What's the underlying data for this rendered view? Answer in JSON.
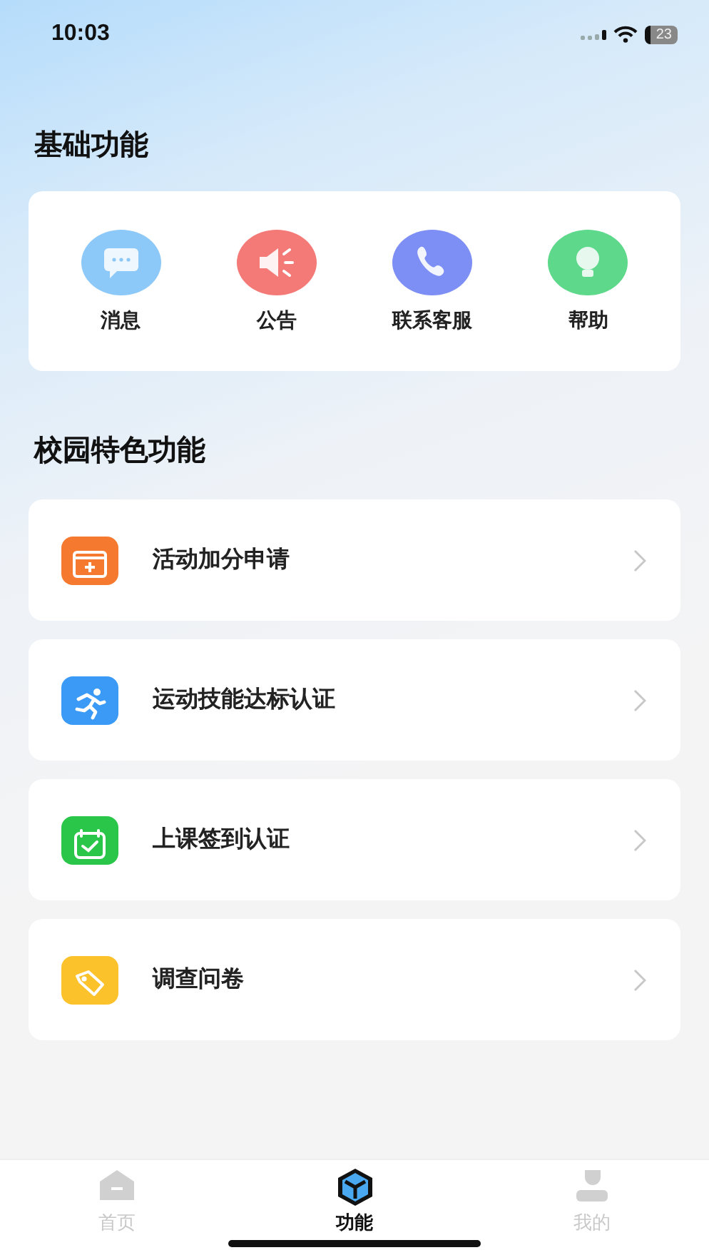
{
  "status_bar": {
    "time": "10:03",
    "battery": "23"
  },
  "basic_section": {
    "title": "基础功能",
    "items": [
      {
        "label": "消息",
        "color": "#8cc8f8"
      },
      {
        "label": "公告",
        "color": "#f47a78"
      },
      {
        "label": "联系客服",
        "color": "#7d8ef5"
      },
      {
        "label": "帮助",
        "color": "#5ed88a"
      }
    ]
  },
  "campus_section": {
    "title": "校园特色功能",
    "items": [
      {
        "label": "活动加分申请",
        "color": "#f57a30"
      },
      {
        "label": "运动技能达标认证",
        "color": "#3a9af5"
      },
      {
        "label": "上课签到认证",
        "color": "#2ac64a"
      },
      {
        "label": "调查问卷",
        "color": "#fbc22c"
      }
    ]
  },
  "tab_bar": [
    {
      "label": "首页",
      "selected": false
    },
    {
      "label": "功能",
      "selected": true
    },
    {
      "label": "我的",
      "selected": false
    }
  ]
}
